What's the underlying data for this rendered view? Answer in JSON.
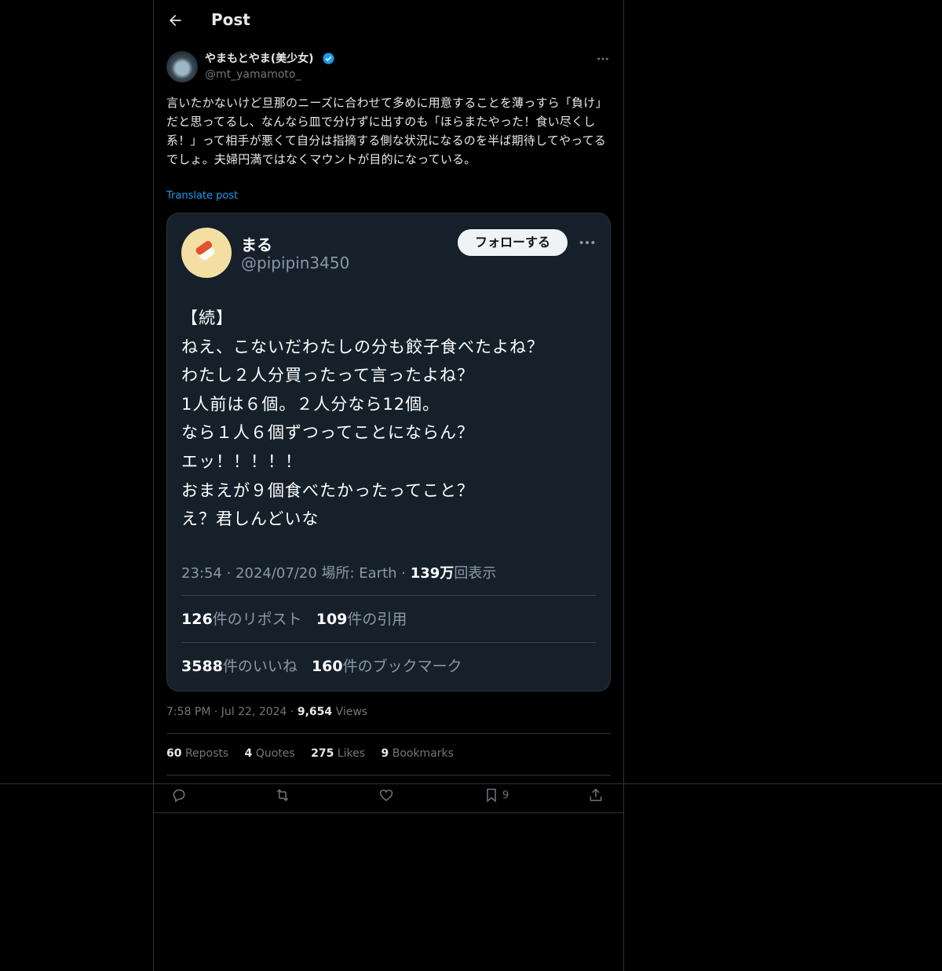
{
  "header": {
    "title": "Post"
  },
  "post": {
    "author_name": "やまもとやま(美少女)",
    "author_handle": "@mt_yamamoto_",
    "text": "言いたかないけど旦那のニーズに合わせて多めに用意することを薄っすら「負け」だと思ってるし、なんなら皿で分けずに出すのも「ほらまたやった！食い尽くし系！」って相手が悪くて自分は指摘する側な状況になるのを半ば期待してやってるでしょ。夫婦円満ではなくマウントが目的になっている。",
    "translate_label": "Translate post",
    "time": "7:58 PM",
    "date": "Jul 22, 2024",
    "views_count": "9,654",
    "views_label": "Views",
    "reposts_count": "60",
    "reposts_label": "Reposts",
    "quotes_count": "4",
    "quotes_label": "Quotes",
    "likes_count": "275",
    "likes_label": "Likes",
    "bookmarks_count": "9",
    "bookmarks_label": "Bookmarks",
    "action_bookmark_count": "9"
  },
  "embedded_screenshot": {
    "name": "まる",
    "handle": "@pipipin3450",
    "follow_label": "フォローする",
    "lines": [
      "【続】",
      "ねえ、こないだわたしの分も餃子食べたよね？",
      "わたし２人分買ったって言ったよね？",
      "1人前は６個。２人分なら12個。",
      "なら１人６個ずつってことにならん？",
      "エッ！！！！！",
      "おまえが９個食べたかったってこと？",
      "え？君しんどいな"
    ],
    "meta_time": "23:54 · 2024/07/20 場所: Earth · ",
    "meta_views_num": "139万",
    "meta_views_label": "回表示",
    "reposts_num": "126",
    "reposts_label": "件のリポスト",
    "quotes_num": "109",
    "quotes_label": "件の引用",
    "likes_num": "3588",
    "likes_label": "件のいいね",
    "bookmarks_num": "160",
    "bookmarks_label": "件のブックマーク"
  },
  "icons": {
    "back": "arrow-left-icon",
    "verified": "verified-badge-icon",
    "more": "more-horizontal-icon",
    "reply": "reply-icon",
    "repost": "repost-icon",
    "like": "heart-icon",
    "bookmark": "bookmark-icon",
    "share": "share-icon"
  },
  "colors": {
    "background": "#000000",
    "accent": "#1d9bf0",
    "card": "#15202b",
    "muted": "#71767b"
  }
}
